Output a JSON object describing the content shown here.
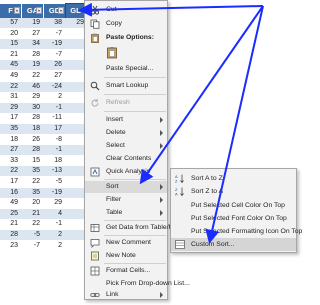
{
  "sheet": {
    "headers": [
      "F",
      "GA",
      "GD",
      "GL"
    ],
    "rows": [
      [
        "57",
        "19",
        "38",
        "29"
      ],
      [
        "20",
        "27",
        "-7",
        ""
      ],
      [
        "15",
        "34",
        "-19",
        ""
      ],
      [
        "21",
        "28",
        "-7",
        ""
      ],
      [
        "45",
        "19",
        "26",
        ""
      ],
      [
        "49",
        "22",
        "27",
        ""
      ],
      [
        "22",
        "46",
        "-24",
        ""
      ],
      [
        "31",
        "29",
        "2",
        ""
      ],
      [
        "29",
        "30",
        "-1",
        ""
      ],
      [
        "17",
        "28",
        "-11",
        ""
      ],
      [
        "35",
        "18",
        "17",
        ""
      ],
      [
        "18",
        "26",
        "-8",
        ""
      ],
      [
        "27",
        "28",
        "-1",
        ""
      ],
      [
        "33",
        "15",
        "18",
        ""
      ],
      [
        "22",
        "35",
        "-13",
        ""
      ],
      [
        "17",
        "22",
        "-5",
        ""
      ],
      [
        "16",
        "35",
        "-19",
        ""
      ],
      [
        "49",
        "20",
        "29",
        ""
      ],
      [
        "25",
        "21",
        "4",
        ""
      ],
      [
        "21",
        "22",
        "-1",
        ""
      ],
      [
        "28",
        "-5",
        "2",
        ""
      ],
      [
        "23",
        "-7",
        "2",
        ""
      ]
    ]
  },
  "menu": {
    "cut": "Cut",
    "copy": "Copy",
    "paste_options": "Paste Options:",
    "paste_special": "Paste Special...",
    "smart_lookup": "Smart Lookup",
    "refresh": "Refresh",
    "insert": "Insert",
    "delete": "Delete",
    "select": "Select",
    "clear_contents": "Clear Contents",
    "quick_analysis": "Quick Analysis",
    "sort": "Sort",
    "filter": "Filter",
    "table": "Table",
    "get_data": "Get Data from Table/Range...",
    "new_comment": "New Comment",
    "new_note": "New Note",
    "format_cells": "Format Cells...",
    "pick_list": "Pick From Drop-down List...",
    "link": "Link"
  },
  "submenu": {
    "sort_az": "Sort A to Z",
    "sort_za": "Sort Z to A",
    "cell_color": "Put Selected Cell Color On Top",
    "font_color": "Put Selected Font Color On Top",
    "format_icon": "Put Selected Formatting Icon On Top",
    "custom_sort": "Custom Sort..."
  },
  "colors": {
    "header": "#3b6ea8",
    "band": "#dce6f1",
    "annotation_arrow": "#1a2cff"
  }
}
